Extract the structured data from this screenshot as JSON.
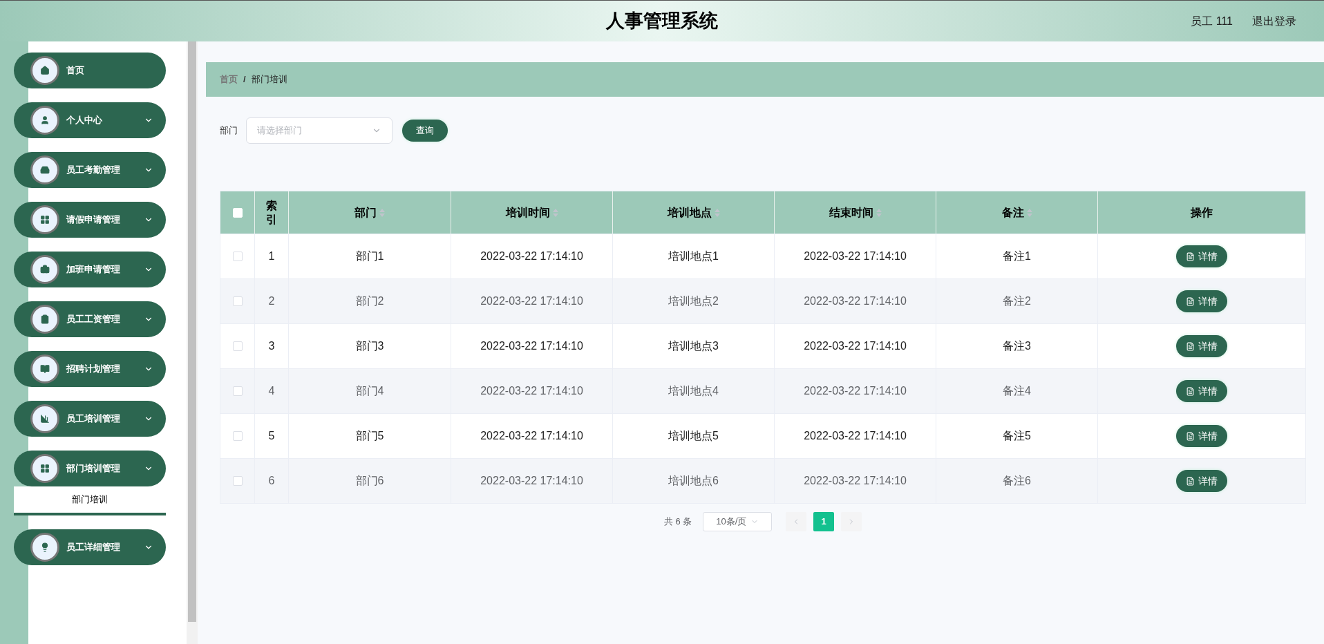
{
  "header": {
    "title": "人事管理系统",
    "user": "员工 111",
    "logout": "退出登录"
  },
  "sidebar": {
    "items": [
      {
        "label": "首页",
        "kind": "link"
      },
      {
        "label": "个人中心",
        "kind": "group"
      },
      {
        "label": "员工考勤管理",
        "kind": "group"
      },
      {
        "label": "请假申请管理",
        "kind": "group"
      },
      {
        "label": "加班申请管理",
        "kind": "group"
      },
      {
        "label": "员工工资管理",
        "kind": "group"
      },
      {
        "label": "招聘计划管理",
        "kind": "group"
      },
      {
        "label": "员工培训管理",
        "kind": "group"
      },
      {
        "label": "部门培训管理",
        "kind": "group",
        "children": [
          {
            "label": "部门培训",
            "selected": true
          }
        ]
      },
      {
        "label": "员工详细管理",
        "kind": "group"
      }
    ]
  },
  "breadcrumb": {
    "items": [
      "首页",
      "部门培训"
    ],
    "separator": "/"
  },
  "filter": {
    "label": "部门",
    "placeholder": "请选择部门",
    "button": "查询"
  },
  "table": {
    "select_all_checked": false,
    "columns": [
      {
        "label": "索引",
        "sortable": false
      },
      {
        "label": "部门",
        "sortable": true
      },
      {
        "label": "培训时间",
        "sortable": true
      },
      {
        "label": "培训地点",
        "sortable": true
      },
      {
        "label": "结束时间",
        "sortable": true
      },
      {
        "label": "备注",
        "sortable": true
      },
      {
        "label": "操作",
        "sortable": false
      }
    ],
    "rows": [
      {
        "checked": false,
        "cells": [
          "1",
          "部门1",
          "2022-03-22 17:14:10",
          "培训地点1",
          "2022-03-22 17:14:10",
          "备注1"
        ],
        "action": "详情"
      },
      {
        "checked": false,
        "cells": [
          "2",
          "部门2",
          "2022-03-22 17:14:10",
          "培训地点2",
          "2022-03-22 17:14:10",
          "备注2"
        ],
        "action": "详情"
      },
      {
        "checked": false,
        "cells": [
          "3",
          "部门3",
          "2022-03-22 17:14:10",
          "培训地点3",
          "2022-03-22 17:14:10",
          "备注3"
        ],
        "action": "详情"
      },
      {
        "checked": false,
        "cells": [
          "4",
          "部门4",
          "2022-03-22 17:14:10",
          "培训地点4",
          "2022-03-22 17:14:10",
          "备注4"
        ],
        "action": "详情"
      },
      {
        "checked": false,
        "cells": [
          "5",
          "部门5",
          "2022-03-22 17:14:10",
          "培训地点5",
          "2022-03-22 17:14:10",
          "备注5"
        ],
        "action": "详情"
      },
      {
        "checked": false,
        "cells": [
          "6",
          "部门6",
          "2022-03-22 17:14:10",
          "培训地点6",
          "2022-03-22 17:14:10",
          "备注6"
        ],
        "action": "详情"
      }
    ]
  },
  "pagination": {
    "total": "共 6 条",
    "page_size": "10条/页",
    "pages": [
      {
        "label": "1",
        "selected": true
      }
    ]
  }
}
